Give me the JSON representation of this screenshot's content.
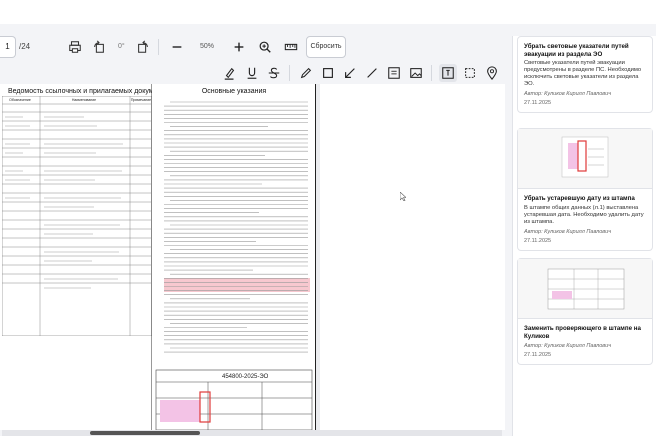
{
  "toolbar": {
    "page_current": "1",
    "page_total": "/24",
    "rotation": "0°",
    "zoom": "50%",
    "reset_label": "Сбросить"
  },
  "document": {
    "page1_title": "Ведомость ссылочных и прилагаемых документов",
    "page1_table_headers": [
      "Обозначение",
      "Наименование",
      "Примечание"
    ],
    "page2_title": "Основные указания",
    "stamp_code": "454800-2025-ЭО"
  },
  "comments": [
    {
      "title": "Убрать световые указатели путей эвакуации из раздела ЭО",
      "body": "Световые указатели путей эвакуации предусмотрены в разделе ПС. Необходимо исключить световые указатели из раздела ЭО.",
      "author": "Автор: Куликов Кирилл Павлович",
      "date": "27.11.2025"
    },
    {
      "title": "Убрать устаревшую дату из штампа",
      "body": "В штампе общих данных (л.1) выставлена устаревшая дата. Необходимо удалить дату из штампа.",
      "author": "Автор: Куликов Кирилл Павлович",
      "date": "27.11.2025"
    },
    {
      "title": "Заменить проверяющего в штампе на Куликов",
      "body": "",
      "author": "Автор: Куликов Кирилл Павлович",
      "date": "27.11.2025"
    }
  ],
  "colors": {
    "highlight": "#f7c8cf",
    "accent_red": "#e03a3a",
    "scroll_thumb": "#555555"
  },
  "icons": [
    "print-icon",
    "rotate-left-icon",
    "rotate-right-icon",
    "minus-icon",
    "plus-icon",
    "zoom-search-icon",
    "ruler-icon",
    "highlight-pen-icon",
    "underline-icon",
    "strikethrough-icon",
    "pencil-icon",
    "rectangle-icon",
    "arrow-icon",
    "line-icon",
    "textbox-icon",
    "image-icon",
    "text-select-icon",
    "area-select-icon",
    "location-pin-icon"
  ]
}
